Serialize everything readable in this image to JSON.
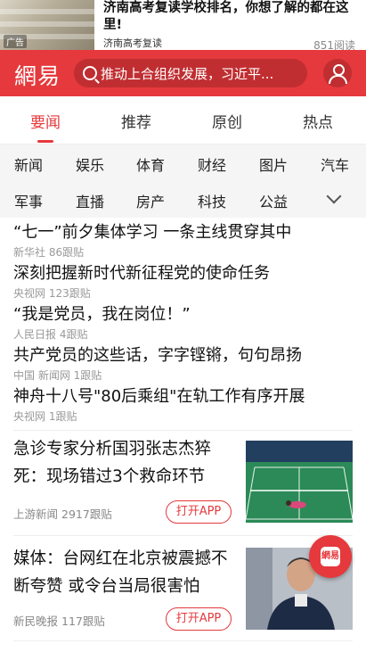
{
  "ad": {
    "tag": "广告",
    "title": "济南高考复读学校排名，你想了解的都在这里!",
    "source": "济南高考复读",
    "reads": "851阅读"
  },
  "header": {
    "logo": "網易",
    "search_placeholder": "推动上合组织发展，习近平..."
  },
  "tabs": [
    "要闻",
    "推荐",
    "原创",
    "热点"
  ],
  "categories": [
    "新闻",
    "娱乐",
    "体育",
    "财经",
    "图片",
    "汽车",
    "军事",
    "直播",
    "房产",
    "科技",
    "公益"
  ],
  "headlines": [
    {
      "title": "“七一”前夕集体学习 一条主线贯穿其中",
      "source": "新华社",
      "follows": "86跟贴"
    },
    {
      "title": "深刻把握新时代新征程党的使命任务",
      "source": "央视网",
      "follows": "123跟贴"
    },
    {
      "title": "“我是党员，我在岗位！”",
      "source": "人民日报",
      "follows": "4跟贴"
    },
    {
      "title": "共产党员的这些话，字字铿锵，句句昂扬",
      "source": "中国 新闻网",
      "follows": "1跟贴"
    },
    {
      "title": "神舟十八号\"80后乘组\"在轨工作有序开展",
      "source": "央视网",
      "follows": "1跟贴"
    }
  ],
  "articles": [
    {
      "title": "急诊专家分析国羽张志杰猝死：现场错过3个救命环节",
      "source": "上游新闻",
      "follows": "2917跟贴",
      "button": "打开APP"
    },
    {
      "title": "媒体：台网红在北京被震撼不断夸赞 或令台当局很害怕",
      "source": "新民晚报",
      "follows": "117跟贴",
      "button": "打开APP"
    }
  ],
  "float_button": "網易",
  "colors": {
    "brand": "#e5393d"
  }
}
